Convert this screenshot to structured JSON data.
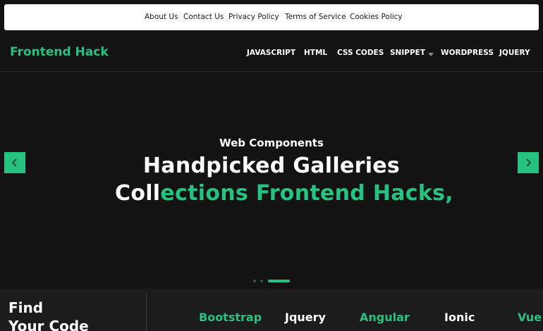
{
  "topbar": {
    "links": [
      "About Us",
      "Contact Us",
      "Privacy Policy",
      "Terms of Service",
      "Cookies Policy"
    ]
  },
  "navbar": {
    "logo": "Frontend Hack",
    "menu": [
      "JAVASCRIPT",
      "HTML",
      "CSS CODES",
      "SNIPPET",
      "WORDPRESS",
      "JQUERY"
    ]
  },
  "hero": {
    "subtitle": "Web Components",
    "title": "Handpicked Galleries",
    "typed_white": "Coll",
    "typed_green": "ections Frontend Hacks,",
    "active_slide": 3,
    "slide_count": 3
  },
  "bottom": {
    "find_title_line1": "Find",
    "find_title_line2": "Your Code",
    "tags": [
      {
        "label": "Bootstrap",
        "color": "#26c281"
      },
      {
        "label": "Jquery",
        "color": "#ffffff"
      },
      {
        "label": "Angular",
        "color": "#26c281"
      },
      {
        "label": "Ionic",
        "color": "#ffffff"
      },
      {
        "label": "Vue",
        "color": "#26c281"
      }
    ]
  },
  "colors": {
    "accent": "#26c281",
    "background": "#131313",
    "panel": "#1c1c1c"
  },
  "icons": {
    "prev": "chevron-left-icon",
    "next": "chevron-right-icon",
    "dropdown": "caret-down-icon"
  }
}
